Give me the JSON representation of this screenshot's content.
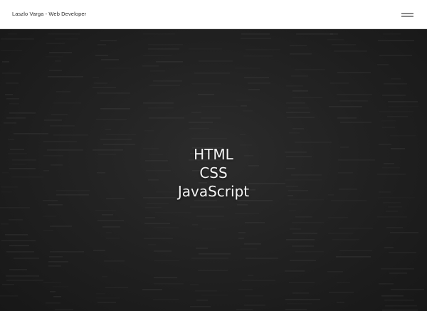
{
  "header": {
    "title": "Laszlo Varga - Web Developer",
    "menu_icon": "hamburger-menu-icon"
  },
  "hero": {
    "lines": [
      "HTML",
      "CSS",
      "JavaScript"
    ],
    "background": "dark code texture"
  },
  "colors": {
    "header_bg": "#ffffff",
    "hero_bg": "#1f1f1f",
    "hero_text": "#f4f4f4"
  }
}
